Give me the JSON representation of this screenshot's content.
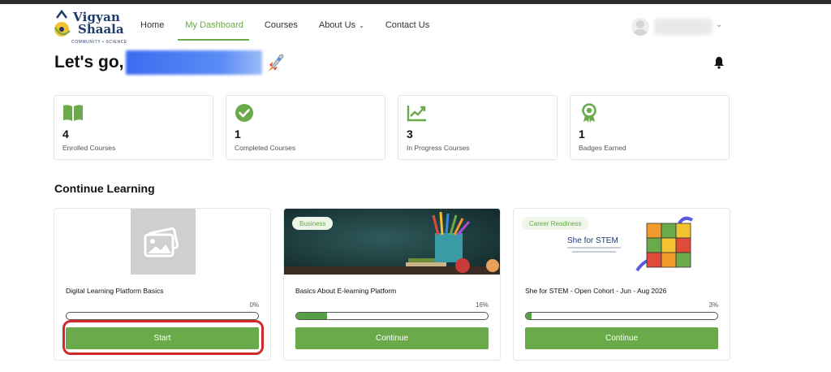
{
  "brand": {
    "name_line1": "Vigyan",
    "name_line2": "Shaala",
    "tagline": "COMMUNITY • SCIENCE",
    "accent_color": "#6aaa4a"
  },
  "nav": {
    "items": [
      {
        "label": "Home"
      },
      {
        "label": "My Dashboard",
        "active": true
      },
      {
        "label": "Courses"
      },
      {
        "label": "About Us",
        "has_dropdown": true
      },
      {
        "label": "Contact Us"
      }
    ]
  },
  "greeting": {
    "text": "Let's go,",
    "icon": "rocket-icon"
  },
  "stats": [
    {
      "icon": "book-icon",
      "value": "4",
      "label": "Enrolled Courses"
    },
    {
      "icon": "check-circle-icon",
      "value": "1",
      "label": "Completed Courses"
    },
    {
      "icon": "trending-chart-icon",
      "value": "3",
      "label": "In Progress Courses"
    },
    {
      "icon": "award-ribbon-icon",
      "value": "1",
      "label": "Badges Earned"
    }
  ],
  "continue_learning": {
    "title": "Continue Learning",
    "courses": [
      {
        "title": "Digital Learning Platform Basics",
        "progress_pct": 0,
        "progress_label": "0%",
        "button": "Start",
        "badge": ""
      },
      {
        "title": "Basics About E-learning Platform",
        "progress_pct": 16,
        "progress_label": "16%",
        "button": "Continue",
        "badge": "Business"
      },
      {
        "title": "She for STEM - Open Cohort - Jun - Aug 2026",
        "progress_pct": 3,
        "progress_label": "3%",
        "button": "Continue",
        "badge": "Career Readiness",
        "image_text": "She for STEM"
      }
    ]
  }
}
